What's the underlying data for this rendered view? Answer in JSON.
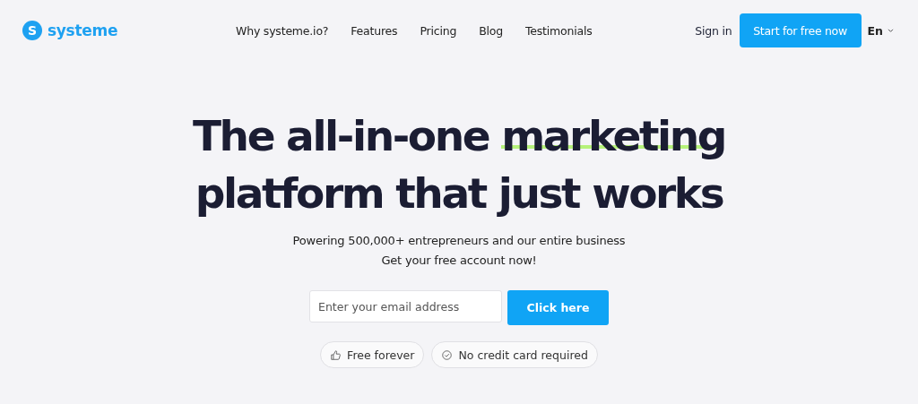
{
  "logo": {
    "mark": "S",
    "name": "systeme"
  },
  "nav": [
    {
      "label": "Why systeme.io?"
    },
    {
      "label": "Features"
    },
    {
      "label": "Pricing"
    },
    {
      "label": "Blog"
    },
    {
      "label": "Testimonials"
    }
  ],
  "sign_in": "Sign in",
  "cta": "Start for free now",
  "language": "En",
  "headline": {
    "lines": [
      [
        {
          "text": "The all-in-one ",
          "highlight": false
        },
        {
          "text": "marketing",
          "highlight": true
        }
      ],
      [
        {
          "text": "platform that just works",
          "highlight": false
        }
      ]
    ]
  },
  "subtitle": [
    "Powering 500,000+ entrepreneurs and our entire business",
    "Get your free account now!"
  ],
  "email": {
    "placeholder": "Enter your email address"
  },
  "submit": "Click here",
  "chips": [
    {
      "kind": "thumb",
      "label": "Free forever"
    },
    {
      "kind": "check",
      "label": "No credit card required"
    }
  ]
}
